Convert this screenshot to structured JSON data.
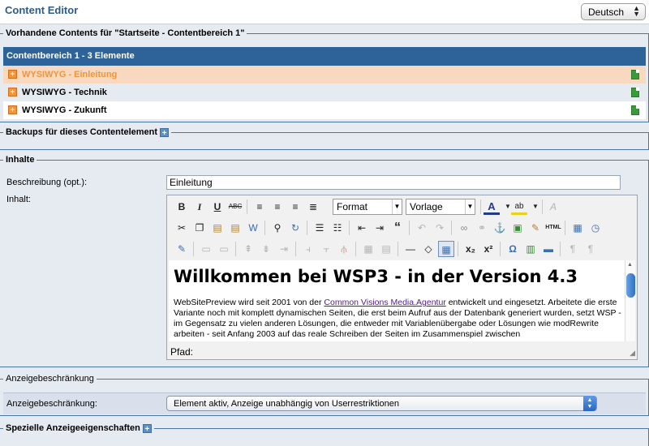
{
  "header": {
    "title": "Content Editor",
    "language": "Deutsch"
  },
  "contents_section": {
    "legend": "Vorhandene Contents für \"Startseite - Contentbereich 1\"",
    "list_header": "Contentbereich 1 - 3 Elemente",
    "items": [
      {
        "label": "WYSIWYG - Einleitung"
      },
      {
        "label": "WYSIWYG - Technik"
      },
      {
        "label": "WYSIWYG - Zukunft"
      }
    ]
  },
  "backups_section": {
    "legend": "Backups für dieses Contentelement"
  },
  "inhalte_section": {
    "legend": "Inhalte",
    "beschreibung_label": "Beschreibung (opt.):",
    "beschreibung_value": "Einleitung",
    "inhalt_label": "Inhalt:",
    "editor": {
      "format_select": "Format",
      "vorlage_select": "Vorlage",
      "html_button": "HTML",
      "heading": "Willkommen bei WSP3 - in der Version 4.3",
      "paragraph_before_link": "WebSitePreview wird seit 2001 von der ",
      "link_text": "Common Visions Media.Agentur",
      "paragraph_after_link": " entwickelt und eingesetzt. Arbeitete die erste Variante noch mit komplett dynamischen Seiten, die erst beim Aufruf aus der Datenbank generiert wurden, setzt WSP - im Gegensatz zu vielen anderen Lösungen, die entweder mit Variablenübergabe oder Lösungen wie modRewrite arbeiten - seit Anfang 2003 auf das reale Schreiben der Seiten im Zusammenspiel zwischen",
      "path_label": "Pfad:"
    }
  },
  "anzeige_section": {
    "legend": "Anzeigebeschränkung",
    "label": "Anzeigebeschränkung:",
    "selected": "Element aktiv, Anzeige unabhängig von Userrestriktionen"
  },
  "spezielle_section": {
    "legend": "Spezielle Anzeigeeigenschaften"
  },
  "colors": {
    "accent": "#2e639a",
    "highlight_row": "#f8d8bf",
    "highlight_text": "#f0963a",
    "border": "#4a77a7"
  }
}
